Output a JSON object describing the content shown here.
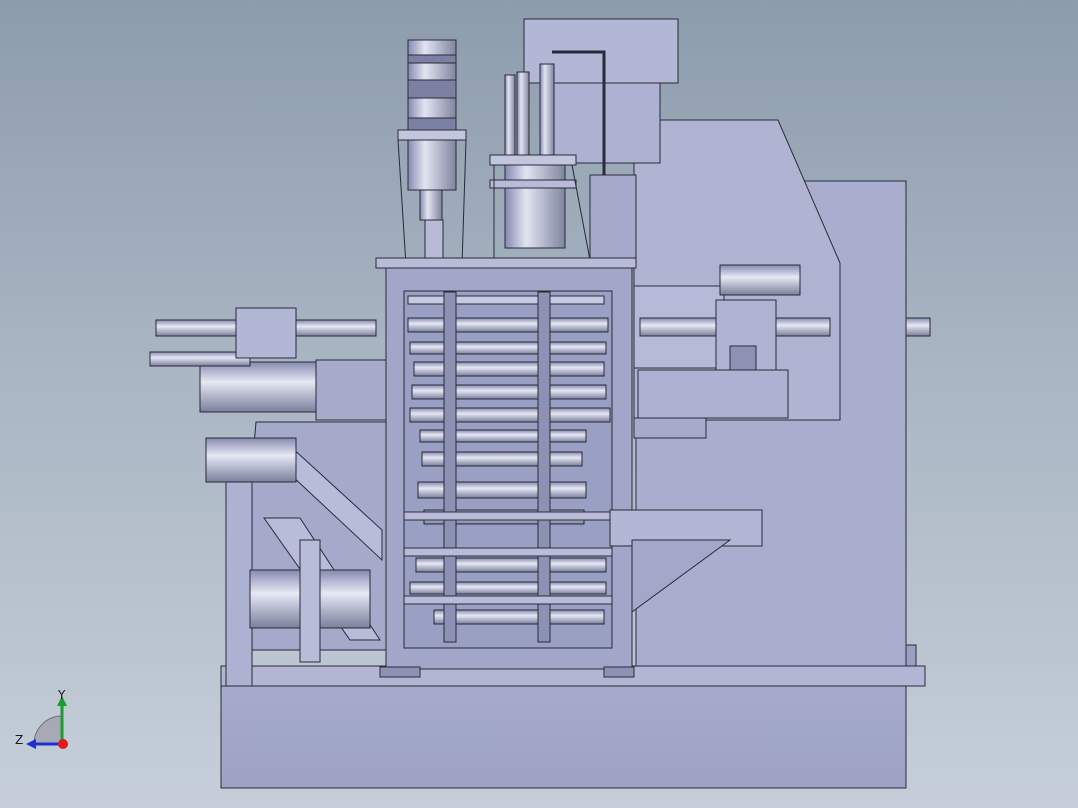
{
  "viewport": {
    "background_top": "#8d9cad",
    "background_bottom": "#c6cfd9",
    "body_color": "#a8adce",
    "body_light": "#c4c8e0",
    "body_dark": "#7f84a8",
    "edge_color": "#2a2a38"
  },
  "triad": {
    "y_label": "Y",
    "z_label": "Z",
    "y_color": "#1f9a2f",
    "z_color": "#1e2fd0",
    "origin_color": "#e01a1a"
  }
}
